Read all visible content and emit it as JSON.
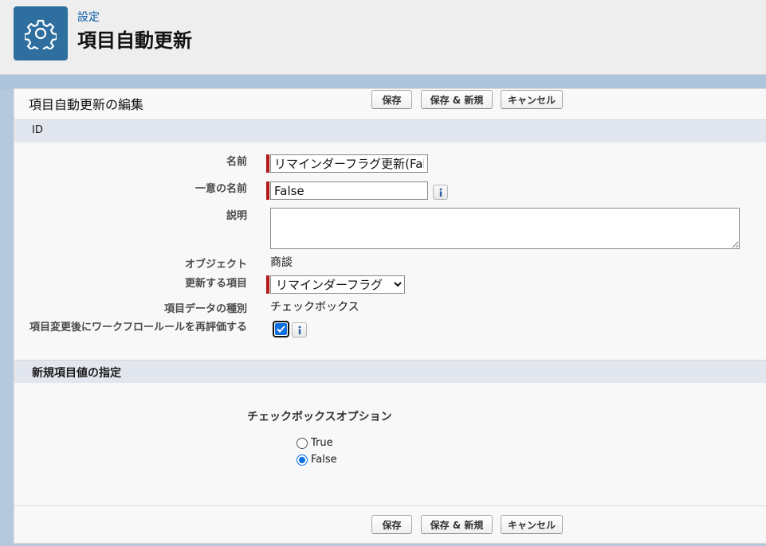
{
  "header": {
    "breadcrumb": "設定",
    "title": "項目自動更新",
    "icon": "gear-icon",
    "icon_bg": "#2f6f9f"
  },
  "form": {
    "title": "項目自動更新の編集",
    "buttons": {
      "save": "保存",
      "save_new": "保存 & 新規",
      "cancel": "キャンセル"
    }
  },
  "sections": {
    "id": "ID",
    "new_value": "新規項目値の指定"
  },
  "fields": {
    "name": {
      "label": "名前",
      "value": "リマインダーフラグ更新(False)"
    },
    "unique_name": {
      "label": "一意の名前",
      "value": "False"
    },
    "description": {
      "label": "説明",
      "value": ""
    },
    "object": {
      "label": "オブジェクト",
      "value": "商談"
    },
    "field_to_update": {
      "label": "更新する項目",
      "value": "リマインダーフラグ"
    },
    "data_type": {
      "label": "項目データの種別",
      "value": "チェックボックス"
    },
    "reevaluate": {
      "label": "項目変更後にワークフロールールを再評価する",
      "checked": true
    }
  },
  "checkbox_options": {
    "title": "チェックボックスオプション",
    "options": [
      {
        "label": "True",
        "selected": false
      },
      {
        "label": "False",
        "selected": true
      }
    ]
  },
  "colors": {
    "required_bar": "#b31919",
    "accent": "#0b6fe0",
    "section_bg": "#e2e6ef"
  }
}
